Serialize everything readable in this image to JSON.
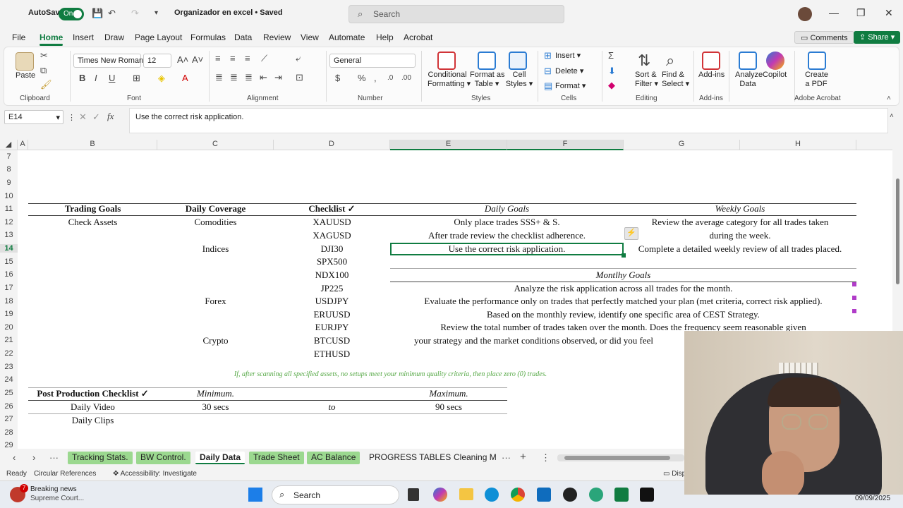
{
  "title_bar": {
    "autosave_label": "AutoSave",
    "autosave_state": "On",
    "document_title": "Organizador en excel • Saved",
    "search_placeholder": "Search"
  },
  "menu": [
    "File",
    "Home",
    "Insert",
    "Draw",
    "Page Layout",
    "Formulas",
    "Data",
    "Review",
    "View",
    "Automate",
    "Help",
    "Acrobat"
  ],
  "menu_active": "Home",
  "comments_label": "Comments",
  "share_label": "Share",
  "ribbon": {
    "paste": "Paste",
    "clipboard": "Clipboard",
    "font_name": "Times New Roman",
    "font_size": "12",
    "font": "Font",
    "alignment": "Alignment",
    "number_format": "General",
    "number": "Number",
    "conditional_formatting": [
      "Conditional",
      "Formatting"
    ],
    "format_as_table": [
      "Format as",
      "Table"
    ],
    "cell_styles": [
      "Cell",
      "Styles"
    ],
    "styles": "Styles",
    "insert": "Insert",
    "delete": "Delete",
    "format": "Format",
    "cells": "Cells",
    "sort_filter": [
      "Sort &",
      "Filter"
    ],
    "find_select": [
      "Find &",
      "Select"
    ],
    "editing": "Editing",
    "add_ins": "Add-ins",
    "add_ins_group": "Add-ins",
    "analyze_data": [
      "Analyze",
      "Data"
    ],
    "copilot": "Copilot",
    "create_pdf": [
      "Create",
      "a PDF"
    ],
    "adobe_acrobat": "Adobe Acrobat"
  },
  "formula_bar": {
    "name_box": "E14",
    "fx": "fx",
    "content": "Use the correct risk application."
  },
  "columns": [
    "A",
    "B",
    "C",
    "D",
    "E",
    "F",
    "G",
    "H"
  ],
  "rows": [
    "7",
    "8",
    "9",
    "10",
    "11",
    "12",
    "13",
    "14",
    "15",
    "16",
    "17",
    "18",
    "19",
    "20",
    "21",
    "22",
    "23",
    "24",
    "25",
    "26",
    "27",
    "28",
    "29"
  ],
  "sheet": {
    "headers": {
      "trading_goals": "Trading Goals",
      "daily_coverage": "Daily Coverage",
      "checklist": "Checklist ✓",
      "daily_goals": "Daily Goals",
      "weekly_goals": "Weekly Goals"
    },
    "check_assets": "Check Assets",
    "coverage": [
      "Comodities",
      "Indices",
      "Forex",
      "Crypto"
    ],
    "assets": [
      "XAUUSD",
      "XAGUSD",
      "DJI30",
      "SPX500",
      "NDX100",
      "JP225",
      "USDJPY",
      "ERUUSD",
      "EURJPY",
      "BTCUSD",
      "ETHUSD"
    ],
    "daily_goals": [
      "Only place trades SSS+ & S.",
      "After trade review the checklist adherence.",
      "Use the correct risk application."
    ],
    "weekly_goals": [
      "Review the average category for all trades taken",
      "during the week.",
      "Complete a detailed weekly review of all trades placed."
    ],
    "monthly_header": "Montlhy Goals",
    "monthly_goals": [
      "Analyze the risk application across all trades for the month.",
      "Evaluate the performance only on trades that perfectly matched your plan (met criteria, correct risk applied).",
      "Based on the monthly review, identify one specific area of CEST Strategy.",
      "Review the total number of trades taken over the month. Does the frequency seem reasonable given",
      "your strategy and the market conditions observed, or did you feel"
    ],
    "note": "If, after scanning all specified assets, no setups meet your minimum quality criteria, then place zero (0) trades.",
    "post_header": "Post Production Checklist ✓",
    "minimum": "Minimum.",
    "maximum": "Maximum.",
    "daily_video": "Daily Video",
    "daily_clips": "Daily Clips",
    "min_value": "30 secs",
    "to": "to",
    "max_value": "90 secs"
  },
  "sheet_tabs": [
    "Tracking Stats.",
    "BW Control.",
    "Daily Data",
    "Trade Sheet",
    "AC Balance",
    "PROGRESS TABLES",
    "Cleaning M"
  ],
  "active_tab": "Daily Data",
  "status": {
    "ready": "Ready",
    "circular": "Circular References",
    "accessibility": "Accessibility: Investigate",
    "display": "Disp"
  },
  "taskbar": {
    "news_title": "Breaking news",
    "news_sub": "Supreme Court...",
    "news_badge": "7",
    "search": "Search",
    "date": "09/09/2025"
  },
  "colors": {
    "excel_green": "#107c41",
    "tab_green": "#9bd88f",
    "note_green": "#55a845"
  }
}
